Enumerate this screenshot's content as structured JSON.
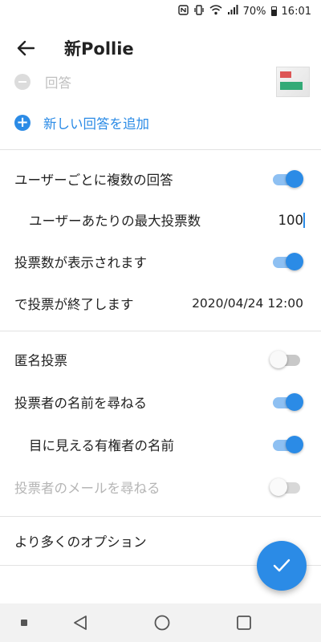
{
  "status_bar": {
    "battery": "70%",
    "time": "16:01",
    "icons": [
      "nfc-icon",
      "vibrate-icon",
      "wifi-icon",
      "signal-icon",
      "battery-icon"
    ]
  },
  "app_bar": {
    "title": "新Pollie",
    "back_icon": "arrow-left-icon"
  },
  "answer_row": {
    "label": "回答"
  },
  "add_answer": {
    "label": "新しい回答を追加"
  },
  "settings": {
    "multiple_answers": {
      "label": "ユーザーごとに複数の回答",
      "on": true
    },
    "max_votes": {
      "label": "ユーザーあたりの最大投票数",
      "value": "100"
    },
    "show_votes": {
      "label": "投票数が表示されます",
      "on": true
    },
    "end_poll": {
      "label": "で投票が終了します",
      "value": "2020/04/24 12:00"
    },
    "anonymous": {
      "label": "匿名投票",
      "on": false
    },
    "ask_name": {
      "label": "投票者の名前を尋ねる",
      "on": true
    },
    "visible_names": {
      "label": "目に見える有権者の名前",
      "on": true
    },
    "ask_email": {
      "label": "投票者のメールを尋ねる",
      "on": false,
      "disabled": true
    },
    "more_options": {
      "label": "より多くのオプション"
    }
  },
  "fab": {
    "icon": "check-icon"
  },
  "nav_bar": {
    "icons": [
      "square-small-icon",
      "back-triangle-icon",
      "home-circle-icon",
      "recents-square-icon"
    ]
  },
  "colors": {
    "accent": "#2b8be6",
    "accent_light": "#8ec0f2",
    "disabled_text": "#b5b5b5"
  }
}
